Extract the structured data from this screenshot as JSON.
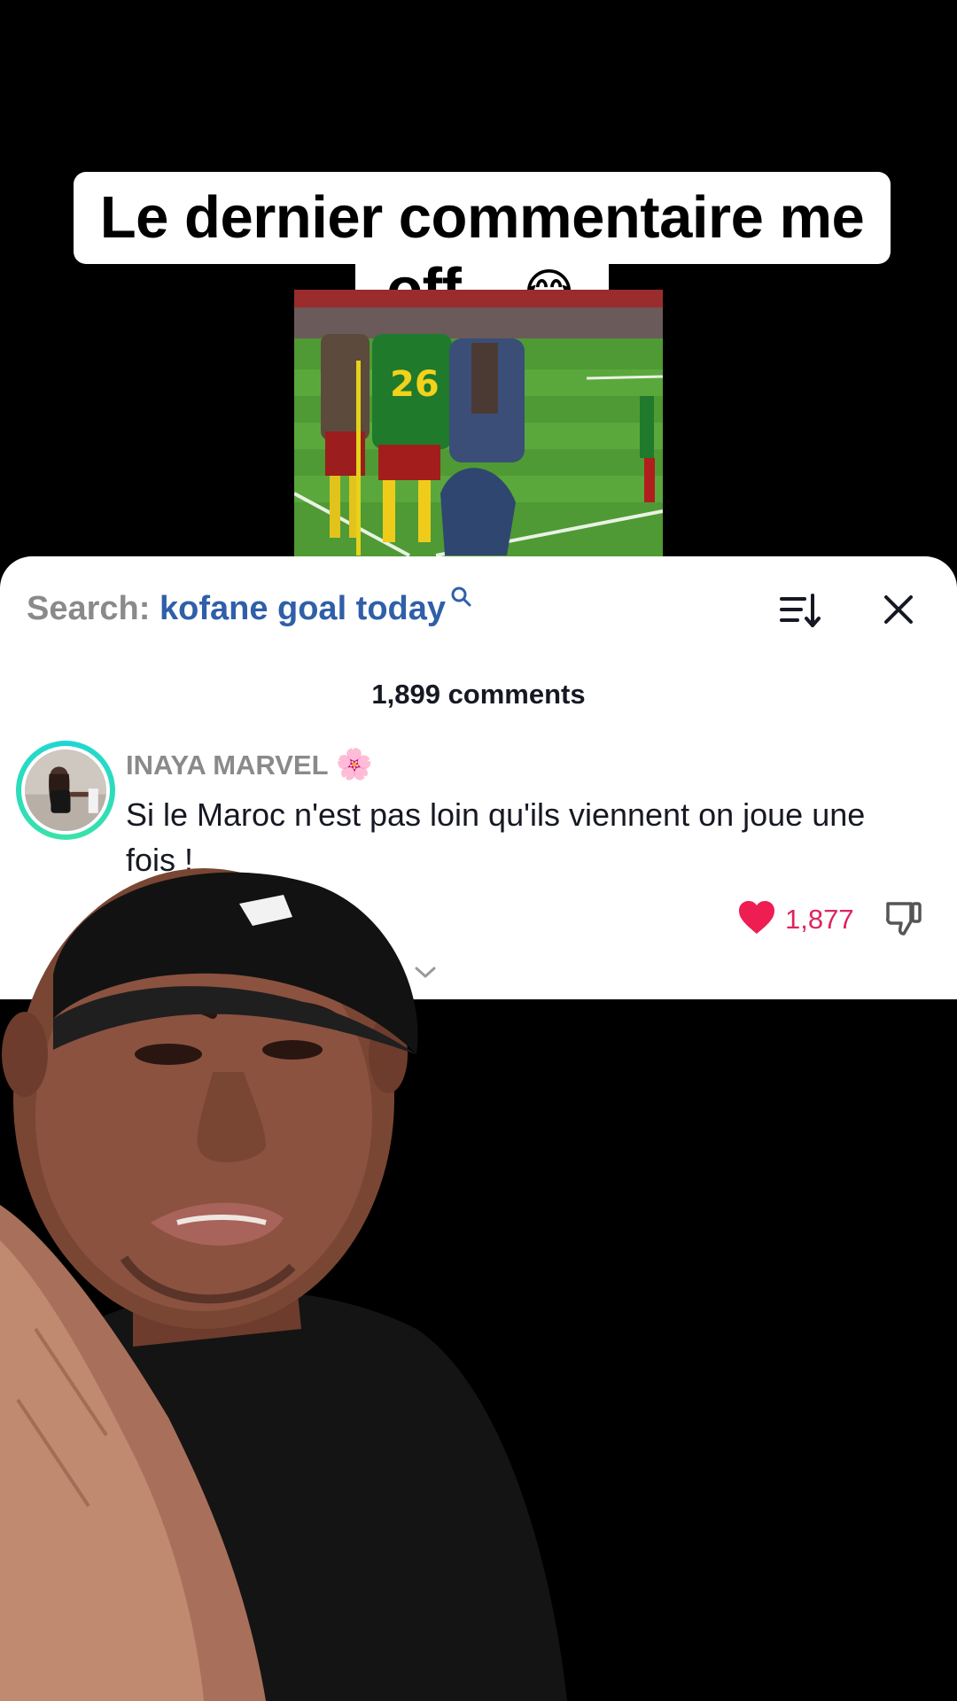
{
  "caption": {
    "line1": "Le dernier commentaire me",
    "line2": "off…",
    "emoji": "😂"
  },
  "comments_panel": {
    "search_prefix": "Search:",
    "search_query": "kofane goal today",
    "comment_count": "1,899 comments",
    "comment": {
      "username": "INAYA MARVEL",
      "username_badge": "🌸",
      "text": "Si le Maroc n'est pas loin qu'ils viennent on joue une fois !",
      "like_count": "1,877"
    }
  },
  "colors": {
    "accent_like": "#e0245e",
    "search_query": "#2f5fa8",
    "avatar_ring": "#1fd6d4",
    "panel_bg": "#ffffff",
    "screen_bg": "#000000"
  },
  "icons": {
    "search": "magnifier-icon",
    "sort": "sort-icon",
    "close": "close-icon",
    "like": "heart-icon",
    "dislike": "thumbs-down-icon",
    "expand": "chevron-down-icon"
  }
}
